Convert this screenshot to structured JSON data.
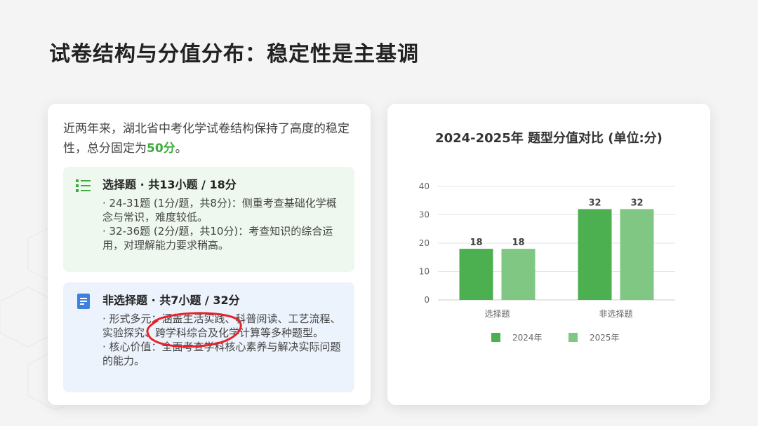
{
  "title": "试卷结构与分值分布：稳定性是主基调",
  "intro": {
    "text_before": "近两年来，湖北省中考化学试卷结构保持了高度的稳定性，总分固定为",
    "highlight": "50分",
    "text_after": "。",
    "accent_color": "#3dab3d"
  },
  "sections": [
    {
      "icon": "list-icon",
      "title": "选择题 · 共13小题 / 18分",
      "items": [
        "· 24-31题 (1分/题，共8分)：侧重考查基础化学概念与常识，难度较低。",
        "· 32-36题 (2分/题，共10分)：考查知识的综合运用，对理解能力要求稍高。"
      ]
    },
    {
      "icon": "document-icon",
      "title": "非选择题 · 共7小题 / 32分",
      "items": [
        "· 形式多元：涵盖生活实践、科普阅读、工艺流程、实验探究、跨学科综合及化学计算等多种题型。",
        "· 核心价值：全面考查学科核心素养与解决实际问题的能力。"
      ]
    }
  ],
  "chart_data": {
    "type": "bar",
    "title": "2024-2025年 题型分值对比 (单位:分)",
    "categories": [
      "选择题",
      "非选择题"
    ],
    "series": [
      {
        "name": "2024年",
        "values": [
          18,
          32
        ],
        "color": "#4caf50"
      },
      {
        "name": "2025年",
        "values": [
          18,
          32
        ],
        "color": "#81c784"
      }
    ],
    "ylim": [
      0,
      40
    ],
    "yticks": [
      0,
      10,
      20,
      30,
      40
    ],
    "grid": true,
    "legend": "bottom",
    "data_labels": true
  }
}
